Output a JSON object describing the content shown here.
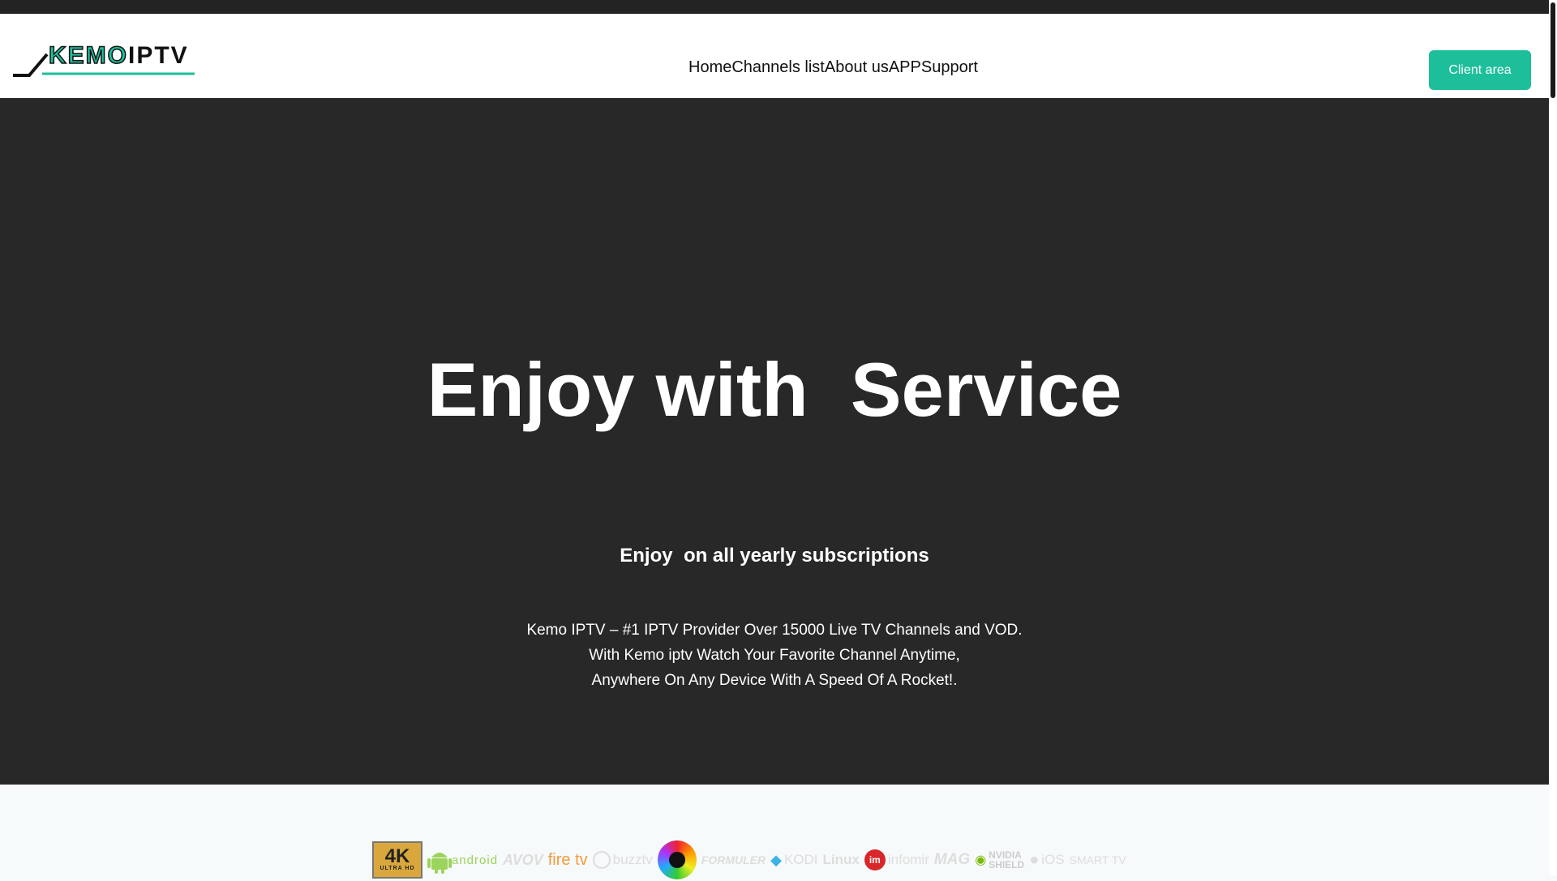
{
  "brand": {
    "logo_part1": "KEMO",
    "logo_part2": "IPTV",
    "accent_color": "#1dbf9b"
  },
  "nav": {
    "items": [
      "Home",
      "Channels list",
      "About us",
      "APP",
      "Support"
    ]
  },
  "header": {
    "client_button": "Client area"
  },
  "hero": {
    "title": "Enjoy with  Service",
    "subtitle": "Enjoy  on all yearly subscriptions",
    "description": [
      "Kemo IPTV – #1 IPTV Provider Over 15000 Live TV Channels and VOD.",
      "With Kemo iptv Watch Your Favorite Channel Anytime,",
      "Anywhere On Any Device With A Speed Of A Rocket!."
    ]
  },
  "devices": {
    "k4_main": "4K",
    "k4_sub": "ULTRA HD",
    "android": "android",
    "avov": "AVOV",
    "firetv": "fire tv",
    "buzztv": "buzztv",
    "formuler": "FORMULER",
    "kodi": "KODI",
    "linux": "Linux",
    "im": "im",
    "infomir": "infomir",
    "mag": "MAG",
    "nvidia": "NVIDIA",
    "shield": "SHIELD",
    "ios": "iOS",
    "smarttv": "SMART TV"
  }
}
